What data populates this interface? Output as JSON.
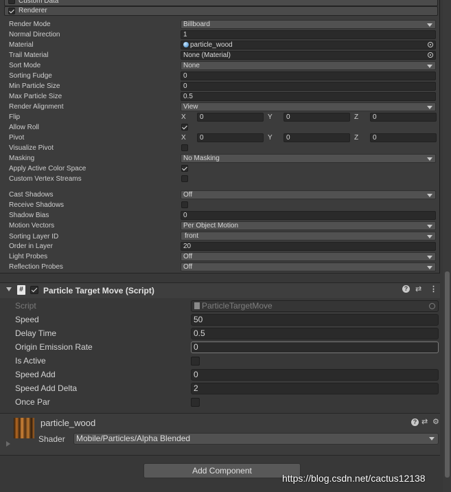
{
  "modules": {
    "custom_data": "Custom Data",
    "renderer": "Renderer"
  },
  "renderer_props": {
    "render_mode": {
      "label": "Render Mode",
      "value": "Billboard"
    },
    "normal_direction": {
      "label": "Normal Direction",
      "value": "1"
    },
    "material": {
      "label": "Material",
      "value": "particle_wood"
    },
    "trail_material": {
      "label": "Trail Material",
      "value": "None (Material)"
    },
    "sort_mode": {
      "label": "Sort Mode",
      "value": "None"
    },
    "sorting_fudge": {
      "label": "Sorting Fudge",
      "value": "0"
    },
    "min_particle_size": {
      "label": "Min Particle Size",
      "value": "0"
    },
    "max_particle_size": {
      "label": "Max Particle Size",
      "value": "0.5"
    },
    "render_alignment": {
      "label": "Render Alignment",
      "value": "View"
    },
    "flip": {
      "label": "Flip",
      "x": "0",
      "y": "0",
      "z": "0"
    },
    "allow_roll": {
      "label": "Allow Roll",
      "checked": true
    },
    "pivot": {
      "label": "Pivot",
      "x": "0",
      "y": "0",
      "z": "0"
    },
    "visualize_pivot": {
      "label": "Visualize Pivot",
      "checked": false
    },
    "masking": {
      "label": "Masking",
      "value": "No Masking"
    },
    "apply_active_color_space": {
      "label": "Apply Active Color Space",
      "checked": true
    },
    "custom_vertex_streams": {
      "label": "Custom Vertex Streams",
      "checked": false
    },
    "cast_shadows": {
      "label": "Cast Shadows",
      "value": "Off"
    },
    "receive_shadows": {
      "label": "Receive Shadows",
      "checked": false
    },
    "shadow_bias": {
      "label": "Shadow Bias",
      "value": "0"
    },
    "motion_vectors": {
      "label": "Motion Vectors",
      "value": "Per Object Motion"
    },
    "sorting_layer_id": {
      "label": "Sorting Layer ID",
      "value": "front"
    },
    "order_in_layer": {
      "label": "Order in Layer",
      "value": "20"
    },
    "light_probes": {
      "label": "Light Probes",
      "value": "Off"
    },
    "reflection_probes": {
      "label": "Reflection Probes",
      "value": "Off"
    }
  },
  "axes": {
    "x": "X",
    "y": "Y",
    "z": "Z"
  },
  "script_component": {
    "title": "Particle Target Move (Script)",
    "script": {
      "label": "Script",
      "value": "ParticleTargetMove"
    },
    "speed": {
      "label": "Speed",
      "value": "50"
    },
    "delay_time": {
      "label": "Delay Time",
      "value": "0.5"
    },
    "origin_emission_rate": {
      "label": "Origin Emission Rate",
      "value": "0"
    },
    "is_active": {
      "label": "Is Active",
      "checked": false
    },
    "speed_add": {
      "label": "Speed Add",
      "value": "0"
    },
    "speed_add_delta": {
      "label": "Speed Add Delta",
      "value": "2"
    },
    "once_par": {
      "label": "Once Par",
      "checked": false
    }
  },
  "material_section": {
    "name": "particle_wood",
    "shader_label": "Shader",
    "shader_value": "Mobile/Particles/Alpha Blended"
  },
  "icons": {
    "help": "?",
    "presets": "⇄",
    "menu": "⋮",
    "settings": "⚙",
    "hash": "#"
  },
  "add_component": "Add Component",
  "watermark": "https://blog.csdn.net/cactus12138"
}
